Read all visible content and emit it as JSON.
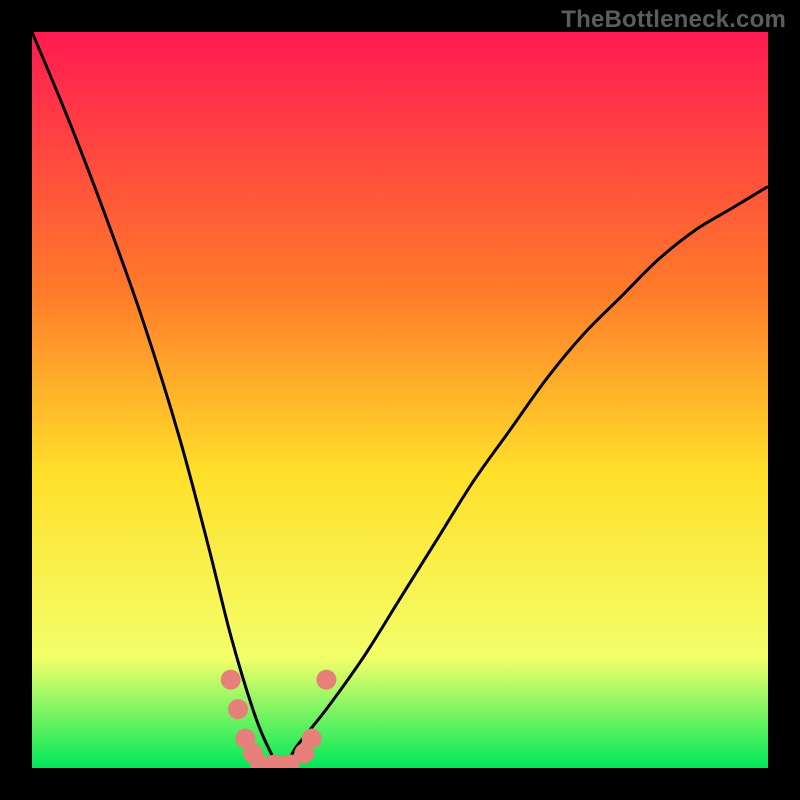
{
  "watermark": "TheBottleneck.com",
  "colors": {
    "frame": "#000000",
    "gradient_top": "#ff1a52",
    "gradient_mid_upper": "#ff7a2a",
    "gradient_mid": "#ffe02a",
    "gradient_lower": "#f3ff6a",
    "gradient_bottom": "#00e85a",
    "curve": "#000000",
    "markers": "#e77f7a"
  },
  "chart_data": {
    "type": "line",
    "title": "",
    "xlabel": "",
    "ylabel": "",
    "xlim": [
      0,
      100
    ],
    "ylim": [
      0,
      100
    ],
    "series": [
      {
        "name": "bottleneck-curve",
        "x": [
          0,
          5,
          10,
          15,
          20,
          24,
          27,
          30,
          32,
          34,
          36,
          40,
          45,
          50,
          55,
          60,
          65,
          70,
          75,
          80,
          85,
          90,
          95,
          100
        ],
        "values": [
          100,
          88,
          75,
          61,
          45,
          30,
          18,
          8,
          3,
          0,
          3,
          8,
          15,
          23,
          31,
          39,
          46,
          53,
          59,
          64,
          69,
          73,
          76,
          79
        ]
      }
    ],
    "markers": [
      {
        "x": 27,
        "y": 12
      },
      {
        "x": 28,
        "y": 8
      },
      {
        "x": 29,
        "y": 4
      },
      {
        "x": 30,
        "y": 2
      },
      {
        "x": 31,
        "y": 0.5
      },
      {
        "x": 33,
        "y": 0.5
      },
      {
        "x": 35,
        "y": 0.5
      },
      {
        "x": 37,
        "y": 2
      },
      {
        "x": 38,
        "y": 4
      },
      {
        "x": 40,
        "y": 12
      }
    ]
  }
}
